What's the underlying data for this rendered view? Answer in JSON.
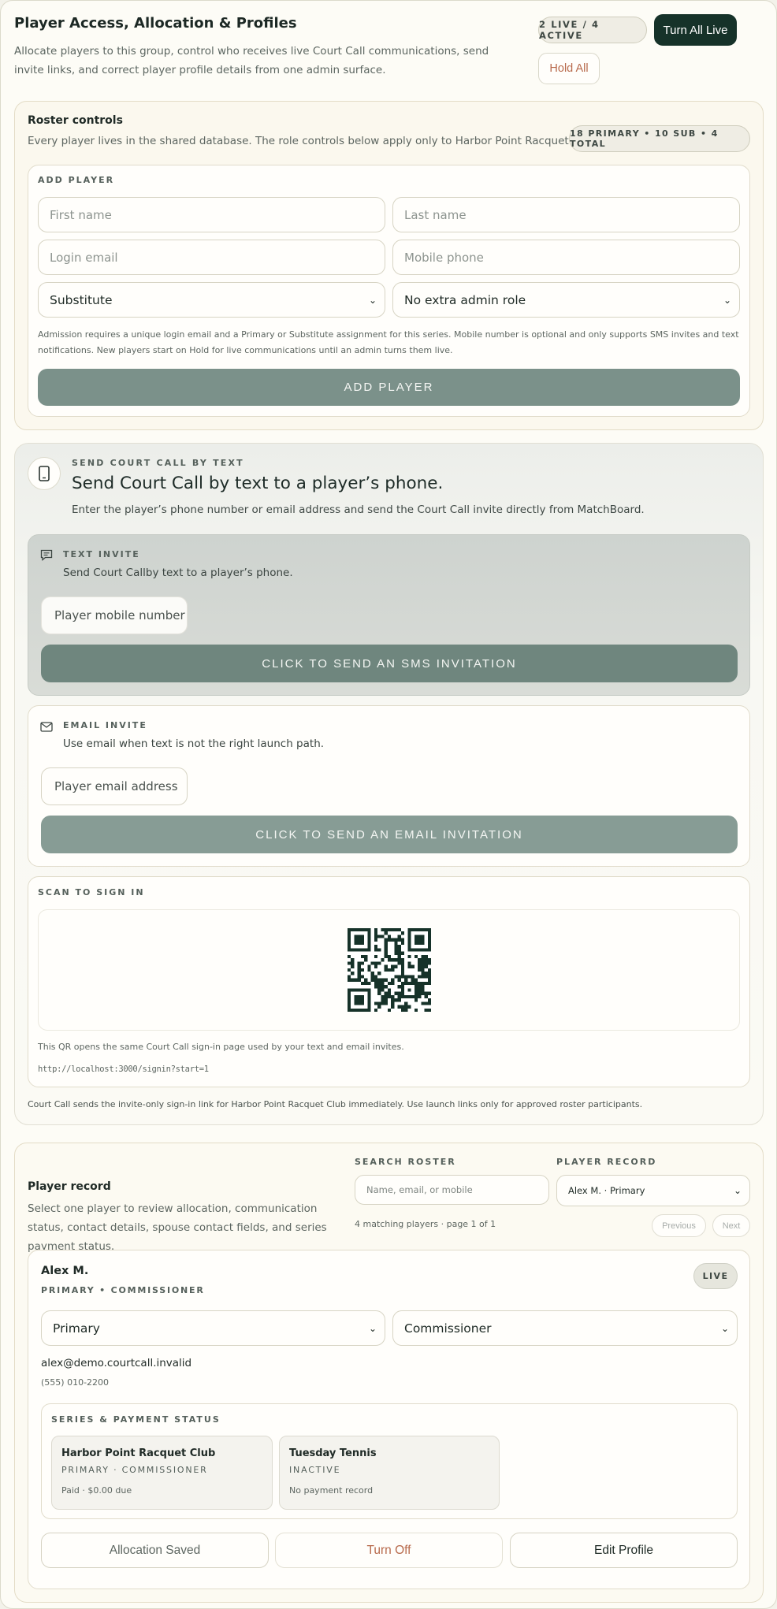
{
  "header": {
    "title": "Player Access, Allocation & Profiles",
    "subtitle": "Allocate players to this group, control who receives live Court Call communications, send invite links, and correct player profile details from one admin surface.",
    "live_badge": "2 LIVE / 4 ACTIVE",
    "turn_all_live": "Turn All Live",
    "hold_all": "Hold All"
  },
  "roster_controls": {
    "title": "Roster controls",
    "description": "Every player lives in the shared database. The role controls below apply only to Harbor Point Racquet Club.",
    "counts_badge": "18 PRIMARY • 10 SUB • 4 TOTAL",
    "add_player": {
      "section_label": "ADD PLAYER",
      "first_name_placeholder": "First name",
      "last_name_placeholder": "Last name",
      "email_placeholder": "Login email",
      "phone_placeholder": "Mobile phone",
      "role_selected": "Substitute",
      "admin_role_selected": "No extra admin role",
      "note": "Admission requires a unique login email and a Primary or Substitute assignment for this series. Mobile number is optional and only supports SMS invites and text notifications. New players start on Hold for live communications until an admin turns them live.",
      "button": "ADD PLAYER"
    }
  },
  "court_call_text": {
    "eyebrow": "SEND COURT CALL BY TEXT",
    "title": "Send Court Call by text to a player’s phone.",
    "description": "Enter the player’s phone number or email address and send the Court Call invite directly from MatchBoard.",
    "text_invite": {
      "label": "TEXT INVITE",
      "description": "Send Court Callby text to a player’s phone.",
      "placeholder": "Player mobile number",
      "button": "CLICK TO SEND AN SMS INVITATION"
    },
    "email_invite": {
      "label": "EMAIL INVITE",
      "description": "Use email when text is not the right launch path.",
      "placeholder": "Player email address",
      "button": "CLICK TO SEND AN EMAIL INVITATION"
    },
    "scan": {
      "label": "SCAN TO SIGN IN",
      "caption": "This QR opens the same Court Call sign-in page used by your text and email invites.",
      "url": "http://localhost:3000/signin?start=1"
    },
    "footer_note": "Court Call sends the invite-only sign-in link for Harbor Point Racquet Club immediately. Use launch links only for approved roster participants."
  },
  "player_record": {
    "title": "Player record",
    "description": "Select one player to review allocation, communication status, contact details, spouse contact fields, and series payment status.",
    "search_label": "SEARCH ROSTER",
    "search_placeholder": "Name, email, or mobile",
    "record_label": "PLAYER RECORD",
    "record_selected": "Alex M. · Primary",
    "match_count": "4 matching players · page 1 of 1",
    "previous": "Previous",
    "next": "Next",
    "player": {
      "name": "Alex M.",
      "roles": "PRIMARY • COMMISSIONER",
      "status": "LIVE",
      "role_selected": "Primary",
      "admin_selected": "Commissioner",
      "email": "alex@demo.courtcall.invalid",
      "phone": "(555) 010-2200"
    },
    "series": {
      "label": "SERIES & PAYMENT STATUS",
      "items": [
        {
          "name": "Harbor Point Racquet Club",
          "role": "PRIMARY · COMMISSIONER",
          "payment": "Paid · $0.00 due"
        },
        {
          "name": "Tuesday Tennis",
          "role": "INACTIVE",
          "payment": "No payment record"
        }
      ]
    },
    "actions": {
      "allocation_saved": "Allocation Saved",
      "turn_off": "Turn Off",
      "edit_profile": "Edit Profile"
    }
  },
  "colors": {
    "brand_dark": "#163229",
    "sage_button": "#7b918a",
    "sms_button": "#6f867e",
    "accent_orange": "#b86a4c"
  }
}
